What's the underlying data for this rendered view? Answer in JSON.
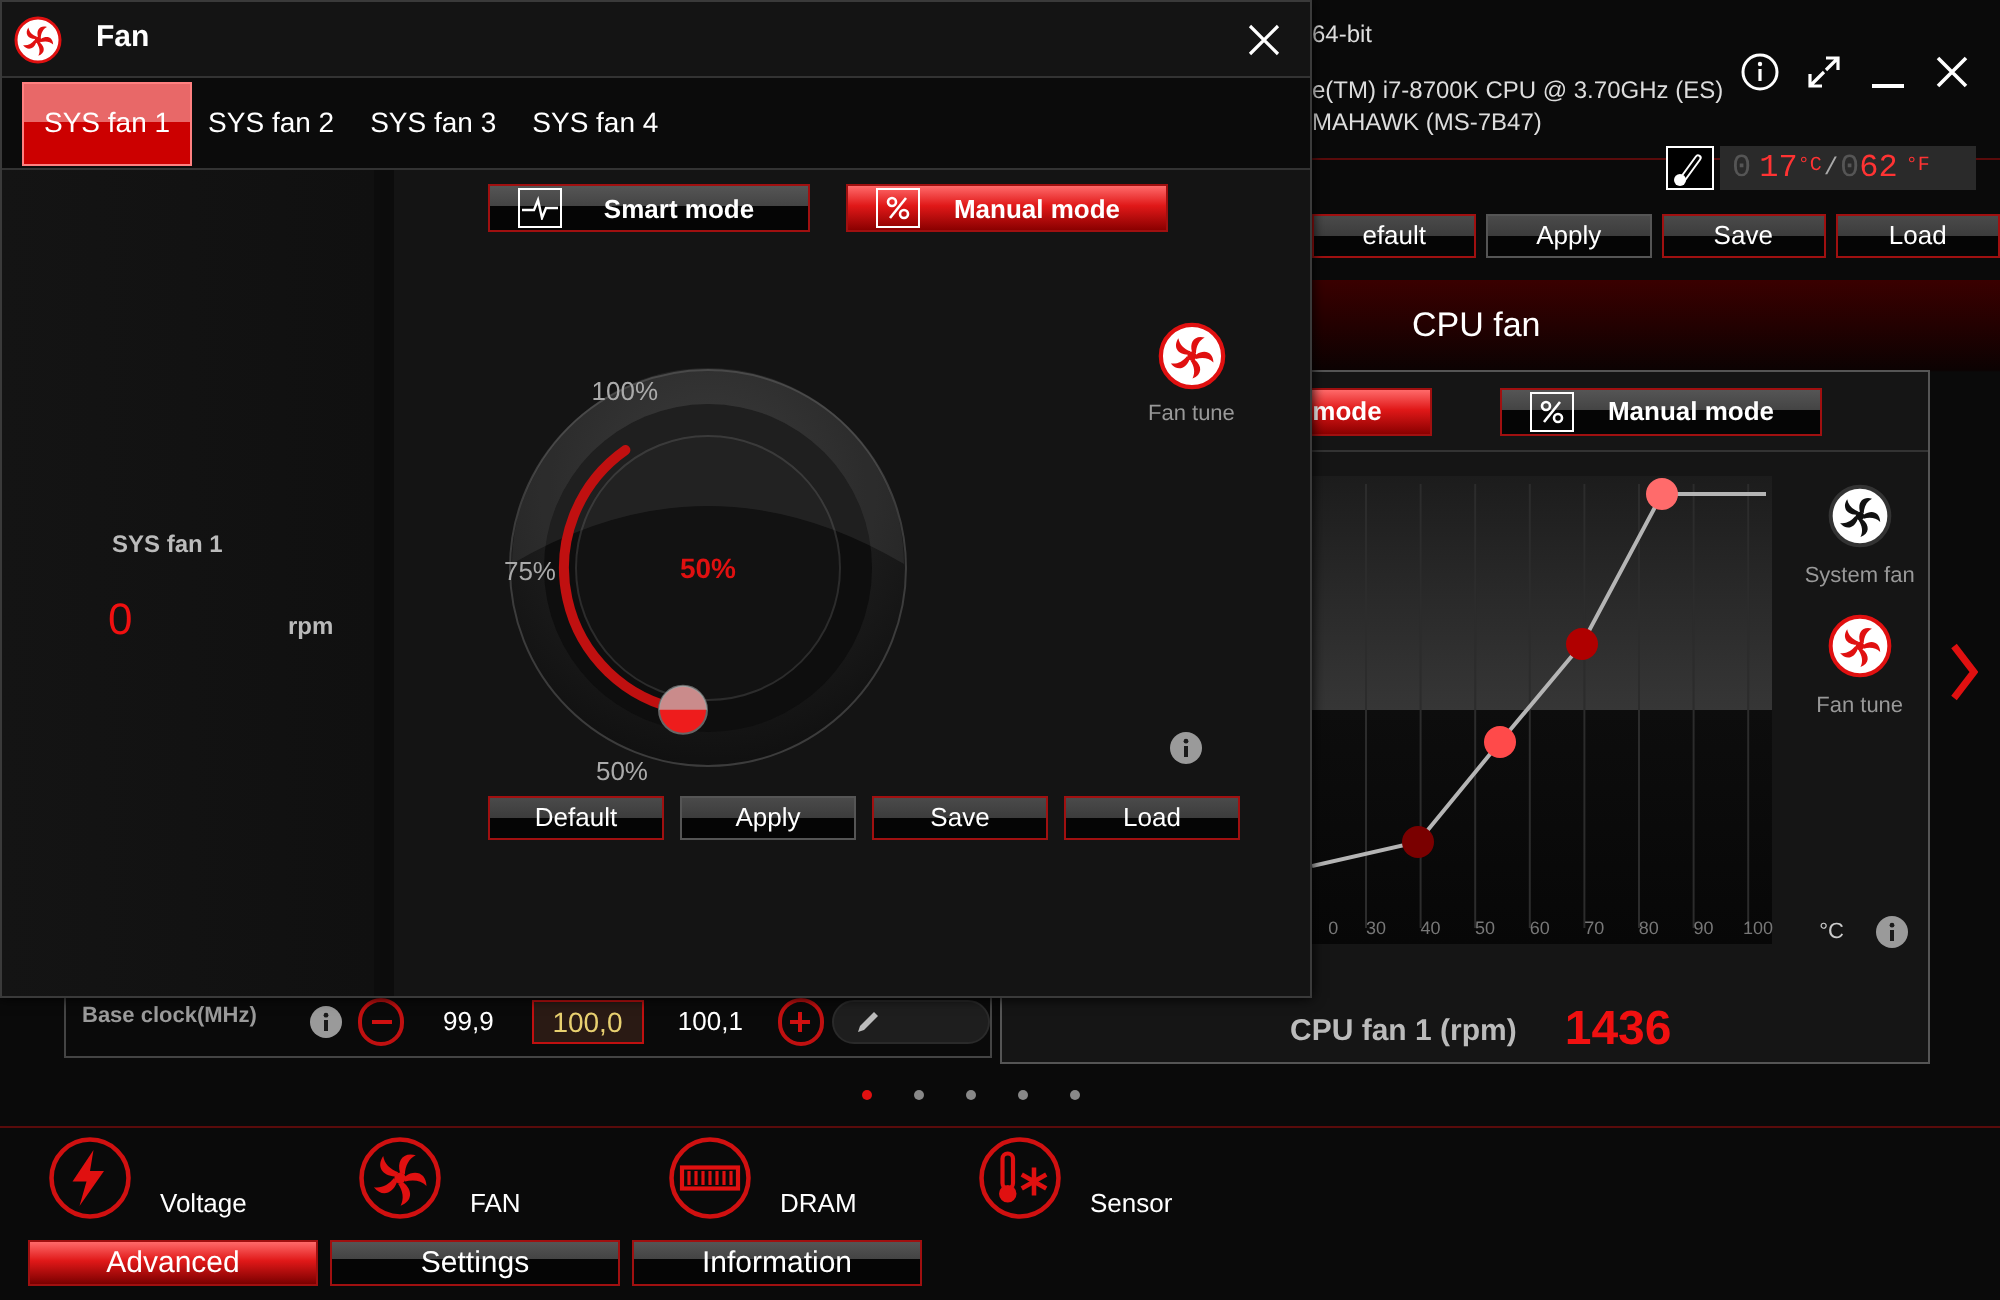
{
  "app": {
    "os": "64-bit",
    "cpu": "e(TM) i7-8700K CPU @ 3.70GHz (ES)",
    "board": "MAHAWK (MS-7B47)",
    "temperature": {
      "celsius_lead": "0",
      "celsius": "17",
      "celsius_unit": "°C",
      "separator": "/",
      "fahrenheit_lead": "0",
      "fahrenheit": "62",
      "fahrenheit_unit": "°F"
    },
    "buttons": [
      {
        "label": "efault",
        "highlighted": true
      },
      {
        "label": "Apply",
        "highlighted": false
      },
      {
        "label": "Save",
        "highlighted": true
      },
      {
        "label": "Load",
        "highlighted": true
      }
    ],
    "fan_title": "CPU fan",
    "modes": [
      {
        "label": "mode",
        "selected": true
      },
      {
        "label": "Manual mode",
        "kind": "manual",
        "selected": false
      }
    ],
    "x_tick_labels": [
      "0",
      "30",
      "40",
      "50",
      "60",
      "70",
      "80",
      "90",
      "100"
    ],
    "unit": "°C",
    "side_items": [
      {
        "label": "System fan",
        "selected": false
      },
      {
        "label": "Fan tune",
        "selected": true
      }
    ],
    "reading_label": "CPU fan 1 (rpm)",
    "reading": "1436",
    "base_clock": {
      "label": "Base clock(MHz)",
      "lower": "99,9",
      "value": "100,0",
      "upper": "100,1"
    },
    "pages": [
      {
        "selected": true
      },
      {
        "selected": false
      },
      {
        "selected": false
      },
      {
        "selected": false
      },
      {
        "selected": false
      }
    ],
    "categories": [
      {
        "label": "Voltage",
        "kind": "voltage"
      },
      {
        "label": "FAN",
        "kind": "fan"
      },
      {
        "label": "DRAM",
        "kind": "dram"
      },
      {
        "label": "Sensor",
        "kind": "sensor"
      }
    ],
    "tabs": [
      {
        "label": "Advanced",
        "selected": true
      },
      {
        "label": "Settings",
        "selected": false
      },
      {
        "label": "Information",
        "selected": false
      }
    ]
  },
  "dialog": {
    "title": "Fan",
    "tabs": [
      {
        "label": "SYS fan 1",
        "selected": true
      },
      {
        "label": "SYS fan 2",
        "selected": false
      },
      {
        "label": "SYS fan 3",
        "selected": false
      },
      {
        "label": "SYS fan 4",
        "selected": false
      }
    ],
    "fan_name": "SYS fan 1",
    "speed": "0",
    "unit": "rpm",
    "modes": [
      {
        "label": "Smart mode",
        "kind": "smart",
        "selected": false
      },
      {
        "label": "Manual mode",
        "kind": "manual",
        "selected": true
      }
    ],
    "dial": {
      "value": "50%",
      "level": 0,
      "labels": [
        "100%",
        "75%",
        "50%"
      ]
    },
    "fan_tune": "Fan tune",
    "buttons": [
      {
        "label": "Default",
        "highlighted": true
      },
      {
        "label": "Apply",
        "highlighted": false
      },
      {
        "label": "Save",
        "highlighted": true
      },
      {
        "label": "Load",
        "highlighted": true
      }
    ]
  }
}
